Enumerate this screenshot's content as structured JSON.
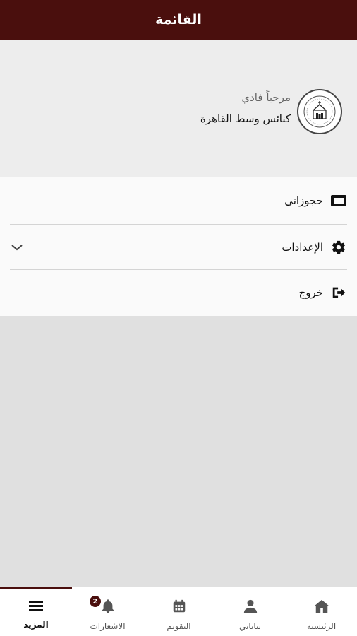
{
  "header": {
    "title": "القائمة"
  },
  "profile": {
    "greeting": "مرحباً فادي",
    "church": "كنائس وسط القاهرة",
    "avatar_icon": "church-logo-icon"
  },
  "menu": {
    "items": [
      {
        "label": "حجوزاتى",
        "icon": "ticket-icon"
      },
      {
        "label": "الإعدادات",
        "icon": "gear-icon",
        "expandable": true
      },
      {
        "label": "خروج",
        "icon": "sign-out-icon"
      }
    ]
  },
  "bottom_nav": {
    "tabs": [
      {
        "label": "المزيد",
        "icon": "menu-icon",
        "active": true
      },
      {
        "label": "الاشعارات",
        "icon": "bell-icon",
        "badge": "2"
      },
      {
        "label": "التقويم",
        "icon": "calendar-icon"
      },
      {
        "label": "بياناتي",
        "icon": "user-icon"
      },
      {
        "label": "الرئيسية",
        "icon": "home-icon"
      }
    ]
  },
  "colors": {
    "primary": "#4a0f0d",
    "background": "#e0e0e0",
    "card": "#fafafa"
  }
}
